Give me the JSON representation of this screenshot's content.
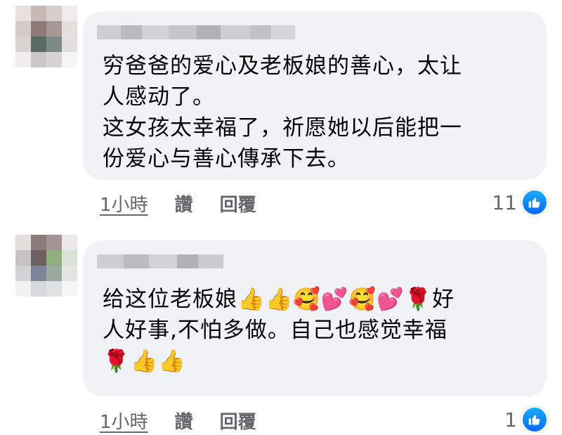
{
  "comments": [
    {
      "text": "穷爸爸的爱心及老板娘的善心，太让\n人感动了。\n这女孩太幸福了，祈愿她以后能把一\n份爱心与善心傳承下去。",
      "time": "1小時",
      "like_label": "讚",
      "reply_label": "回覆",
      "reaction_count": "11"
    },
    {
      "text": "给这位老板娘👍👍🥰💕🥰💕🌹好\n人好事,不怕多做。自己也感觉幸福\n🌹👍👍",
      "time": "1小時",
      "like_label": "讚",
      "reply_label": "回覆",
      "reaction_count": "1"
    }
  ],
  "icons": {
    "reaction": "thumbs-up-icon",
    "avatar": "blurred-avatar",
    "name": "blurred-name"
  },
  "colors": {
    "bubble": "#f0f2f5",
    "like_blue": "#0866ff",
    "meta_gray": "#65676b"
  }
}
